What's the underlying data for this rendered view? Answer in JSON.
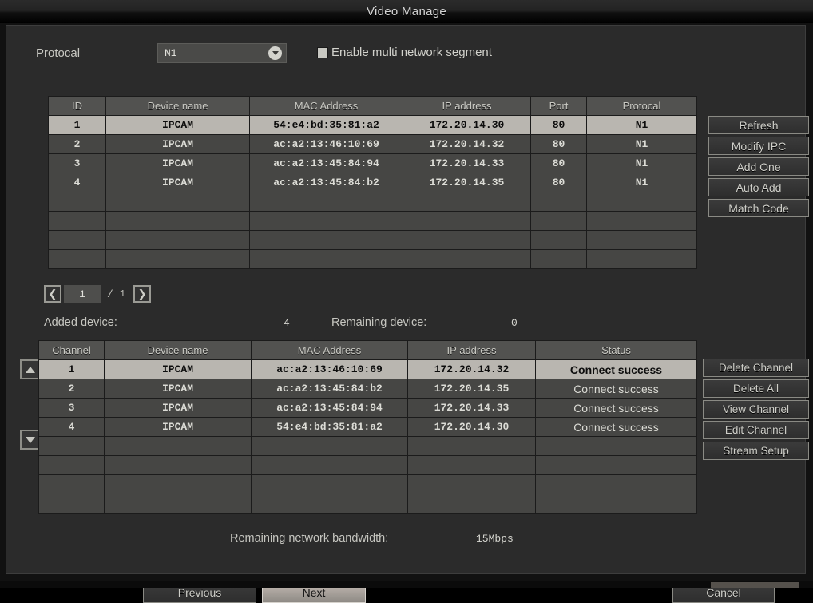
{
  "window": {
    "title": "Video Manage"
  },
  "protocol_row": {
    "label": "Protocal",
    "selected": "N1",
    "chevron_icon": "chevron-down-icon",
    "checkbox_label": "Enable multi network segment",
    "checkbox_checked": true
  },
  "upper_table": {
    "headers": [
      "ID",
      "Device name",
      "MAC Address",
      "IP address",
      "Port",
      "Protocal"
    ],
    "rows": [
      {
        "selected": true,
        "cells": [
          "1",
          "IPCAM",
          "54:e4:bd:35:81:a2",
          "172.20.14.30",
          "80",
          "N1"
        ]
      },
      {
        "selected": false,
        "cells": [
          "2",
          "IPCAM",
          "ac:a2:13:46:10:69",
          "172.20.14.32",
          "80",
          "N1"
        ]
      },
      {
        "selected": false,
        "cells": [
          "3",
          "IPCAM",
          "ac:a2:13:45:84:94",
          "172.20.14.33",
          "80",
          "N1"
        ]
      },
      {
        "selected": false,
        "cells": [
          "4",
          "IPCAM",
          "ac:a2:13:45:84:b2",
          "172.20.14.35",
          "80",
          "N1"
        ]
      },
      {
        "selected": false,
        "cells": [
          "",
          "",
          "",
          "",
          "",
          ""
        ]
      },
      {
        "selected": false,
        "cells": [
          "",
          "",
          "",
          "",
          "",
          ""
        ]
      },
      {
        "selected": false,
        "cells": [
          "",
          "",
          "",
          "",
          "",
          ""
        ]
      },
      {
        "selected": false,
        "cells": [
          "",
          "",
          "",
          "",
          "",
          ""
        ]
      }
    ]
  },
  "upper_buttons": [
    {
      "label": "Refresh"
    },
    {
      "label": "Modify IPC"
    },
    {
      "label": "Add One"
    },
    {
      "label": "Auto Add"
    },
    {
      "label": "Match Code"
    }
  ],
  "pager": {
    "prev_icon": "chevron-left-icon",
    "next_icon": "chevron-right-icon",
    "current_page": "1",
    "separator": "/",
    "total_pages": "1"
  },
  "counters": {
    "added_label": "Added device:",
    "added_value": "4",
    "remaining_label": "Remaining device:",
    "remaining_value": "0"
  },
  "scroll": {
    "up_icon": "triangle-up-icon",
    "down_icon": "triangle-down-icon"
  },
  "lower_table": {
    "headers": [
      "Channel",
      "Device name",
      "MAC Address",
      "IP address",
      "Status"
    ],
    "rows": [
      {
        "selected": true,
        "cells": [
          "1",
          "IPCAM",
          "ac:a2:13:46:10:69",
          "172.20.14.32",
          "Connect success"
        ]
      },
      {
        "selected": false,
        "cells": [
          "2",
          "IPCAM",
          "ac:a2:13:45:84:b2",
          "172.20.14.35",
          "Connect success"
        ]
      },
      {
        "selected": false,
        "cells": [
          "3",
          "IPCAM",
          "ac:a2:13:45:84:94",
          "172.20.14.33",
          "Connect success"
        ]
      },
      {
        "selected": false,
        "cells": [
          "4",
          "IPCAM",
          "54:e4:bd:35:81:a2",
          "172.20.14.30",
          "Connect success"
        ]
      },
      {
        "selected": false,
        "cells": [
          "",
          "",
          "",
          "",
          ""
        ]
      },
      {
        "selected": false,
        "cells": [
          "",
          "",
          "",
          "",
          ""
        ]
      },
      {
        "selected": false,
        "cells": [
          "",
          "",
          "",
          "",
          ""
        ]
      },
      {
        "selected": false,
        "cells": [
          "",
          "",
          "",
          "",
          ""
        ]
      }
    ]
  },
  "lower_buttons": [
    {
      "label": "Delete Channel"
    },
    {
      "label": "Delete All"
    },
    {
      "label": "View Channel"
    },
    {
      "label": "Edit Channel"
    },
    {
      "label": "Stream Setup"
    }
  ],
  "bandwidth": {
    "label": "Remaining network bandwidth:",
    "value": "15Mbps"
  },
  "footer": {
    "previous_label": "Previous",
    "next_label": "Next",
    "cancel_label": "Cancel",
    "next_selected": true
  },
  "colors": {
    "dialog_bg": "#2b2b2b",
    "table_cell_bg": "#464644",
    "table_header_bg": "#525250",
    "row_selected_bg": "#b9b6b0",
    "text": "#c8c8c2",
    "button_border": "#8a8a84"
  }
}
